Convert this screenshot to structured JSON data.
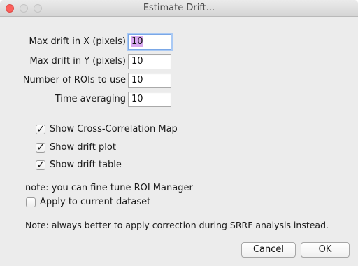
{
  "window": {
    "title": "Estimate Drift..."
  },
  "fields": [
    {
      "label": "Max drift in X (pixels)",
      "value": "10"
    },
    {
      "label": "Max drift in Y (pixels)",
      "value": "10"
    },
    {
      "label": "Number of ROIs to use",
      "value": "10"
    },
    {
      "label": "Time averaging",
      "value": "10"
    }
  ],
  "checkboxes": [
    {
      "label": "Show Cross-Correlation Map",
      "checked": true
    },
    {
      "label": "Show drift plot",
      "checked": true
    },
    {
      "label": "Show drift table",
      "checked": true
    }
  ],
  "note_roi": "note: you can fine tune ROI Manager",
  "apply_checkbox": {
    "label": "Apply to current dataset",
    "checked": false
  },
  "note_bottom": "Note: always better to apply correction during SRRF analysis instead.",
  "buttons": {
    "cancel": "Cancel",
    "ok": "OK"
  },
  "colors": {
    "close_button": "#fc605c",
    "selection_highlight": "#d9a8f0",
    "focus_ring": "#a9c9f4"
  }
}
